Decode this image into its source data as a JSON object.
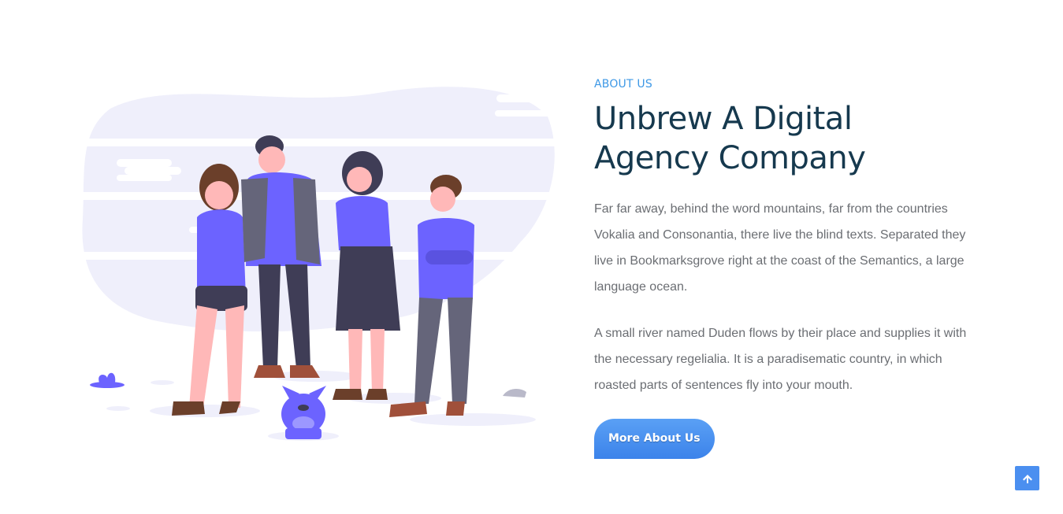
{
  "about": {
    "eyebrow": "ABOUT US",
    "title": "Unbrew A Digital Agency Company",
    "paragraph_1": "Far far away, behind the word mountains, far from the countries Vokalia and Consonantia, there live the blind texts. Separated they live in Bookmarksgrove right at the coast of the Semantics, a large language ocean.",
    "paragraph_2": "A small river named Duden flows by their place and supplies it with the necessary regelialia. It is a paradisematic country, in which roasted parts of sentences fly into your mouth.",
    "cta_label": "More About Us"
  },
  "illustration": {
    "icon": "team-illustration",
    "colors": {
      "blob": "#efeffb",
      "accent": "#6c63ff",
      "dark": "#3f3d56",
      "skin": "#ffb8b8"
    }
  },
  "back_to_top": {
    "icon": "arrow-up-icon"
  },
  "colors": {
    "eyebrow": "#3d98e6",
    "title": "#16394e",
    "body": "#6b6e73",
    "button": "#4b8ff0"
  }
}
